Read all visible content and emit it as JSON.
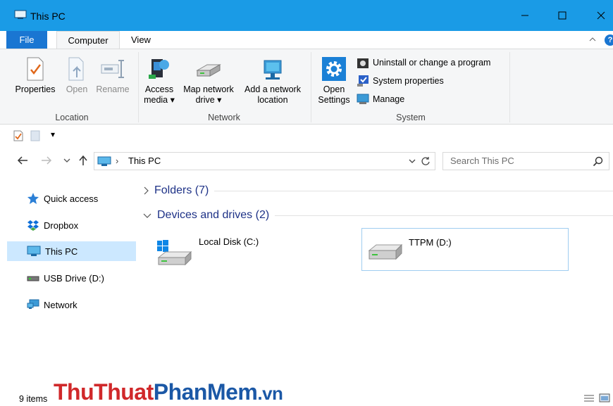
{
  "window": {
    "title": "This PC"
  },
  "menu": {
    "file": "File",
    "tabs": [
      "Computer",
      "View"
    ],
    "active_tab": "Computer"
  },
  "ribbon": {
    "location": {
      "group_label": "Location",
      "properties": "Properties",
      "open": "Open",
      "rename": "Rename"
    },
    "network": {
      "group_label": "Network",
      "access_media_1": "Access",
      "access_media_2": "media ▾",
      "map_drive_1": "Map network",
      "map_drive_2": "drive ▾",
      "add_location_1": "Add a network",
      "add_location_2": "location"
    },
    "system": {
      "group_label": "System",
      "open_settings_1": "Open",
      "open_settings_2": "Settings",
      "uninstall": "Uninstall or change a program",
      "sys_props": "System properties",
      "manage": "Manage"
    }
  },
  "quick_access_toolbar": {
    "dropdown": "▾"
  },
  "address": {
    "path": "This PC",
    "separator": "›",
    "search_placeholder": "Search This PC"
  },
  "nav_pane": {
    "items": [
      {
        "label": "Quick access",
        "icon": "star-icon"
      },
      {
        "label": "Dropbox",
        "icon": "dropbox-icon"
      },
      {
        "label": "This PC",
        "icon": "computer-icon",
        "selected": true
      },
      {
        "label": "USB Drive (D:)",
        "icon": "usb-drive-icon"
      },
      {
        "label": "Network",
        "icon": "network-icon"
      }
    ]
  },
  "content": {
    "folders_header": "Folders (7)",
    "devices_header": "Devices and drives (2)",
    "drives": [
      {
        "label": "Local Disk (C:)",
        "icon": "windows-disk-icon"
      },
      {
        "label": "TTPM (D:)",
        "icon": "disk-icon"
      }
    ]
  },
  "status": {
    "items": "9 items"
  },
  "watermark": {
    "part1": "ThuThuat",
    "part2": "PhanMem",
    "part3": ".vn"
  },
  "colors": {
    "titlebar": "#1a9be6",
    "file_tab": "#1a76d2",
    "selected": "#cce8ff",
    "group_header": "#1e3287",
    "watermark_red": "#d0282a",
    "watermark_blue": "#1b58a6"
  }
}
